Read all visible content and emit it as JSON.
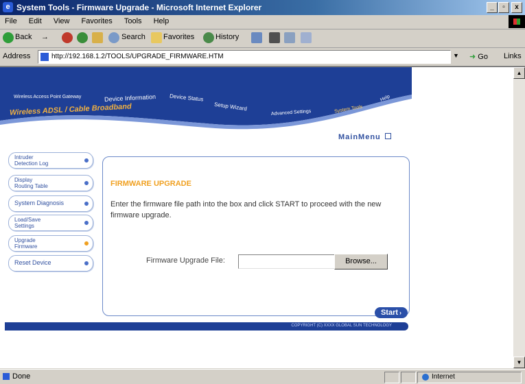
{
  "window": {
    "title": "System Tools - Firmware Upgrade - Microsoft Internet Explorer",
    "min": "_",
    "max": "▫",
    "close": "x"
  },
  "menu": [
    "File",
    "Edit",
    "View",
    "Favorites",
    "Tools",
    "Help"
  ],
  "toolbar": {
    "back": "Back",
    "forward": "→",
    "search": "Search",
    "favorites": "Favorites",
    "history": "History"
  },
  "address": {
    "label": "Address",
    "url": "http://192.168.1.2/TOOLS/UPGRADE_FIRMWARE.HTM",
    "go": "Go",
    "links": "Links"
  },
  "banner": {
    "gateway_name": "Wireless Access Point Gateway",
    "product": "Wireless ADSL / Cable Broadband",
    "nav": [
      "Device Information",
      "Device Status",
      "Setup Wizard",
      "Advanced Settings",
      "System Tools",
      "Help"
    ],
    "main_menu": "MainMenu"
  },
  "sidebar": [
    {
      "line1": "Intruder",
      "line2": "Detection Log"
    },
    {
      "line1": "Display",
      "line2": "Routing Table"
    },
    {
      "line1": "System Diagnosis",
      "line2": ""
    },
    {
      "line1": "Load/Save",
      "line2": "Settings"
    },
    {
      "line1": "Upgrade",
      "line2": "Firmware"
    },
    {
      "line1": "Reset Device",
      "line2": ""
    }
  ],
  "firmware": {
    "title": "FIRMWARE UPGRADE",
    "instructions": "Enter the firmware file path into the box and click START to proceed with the new firmware upgrade.",
    "file_label": "Firmware Upgrade File:",
    "file_value": "",
    "browse": "Browse...",
    "start": "Start"
  },
  "footer": {
    "copyright": "COPYRIGHT (C) XXXX GLOBAL SUN TECHNOLOGY"
  },
  "status": {
    "text": "Done",
    "zone": "Internet"
  },
  "colors": {
    "banner_blue": "#1e3f96",
    "accent_orange": "#f0a020",
    "nav_text_blue": "#2f4f9f"
  }
}
